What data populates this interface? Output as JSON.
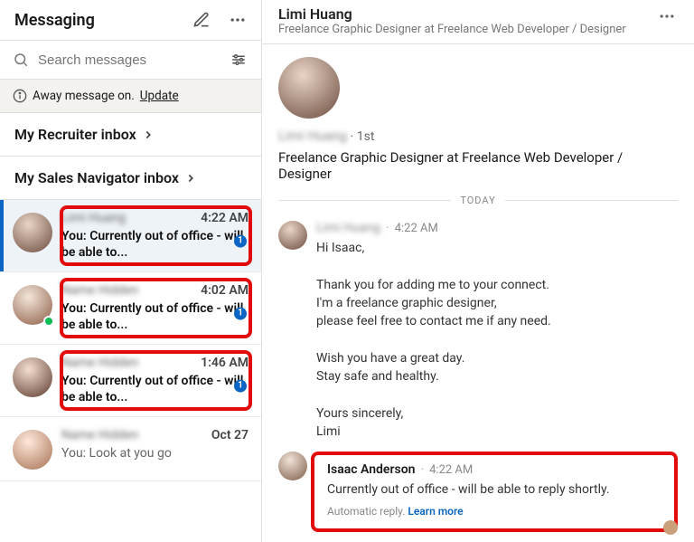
{
  "sidebar": {
    "title": "Messaging",
    "compose_label": "Compose",
    "more_label": "More",
    "search_placeholder": "Search messages",
    "filter_label": "Filter",
    "away_banner": {
      "text": "Away message on.",
      "update_label": "Update"
    },
    "sections": {
      "recruiter": "My Recruiter inbox",
      "sales": "My Sales Navigator inbox"
    },
    "threads": [
      {
        "name": "Limi Huang",
        "time": "4:22 AM",
        "snippet": "You: Currently out of office - will be able to...",
        "unread": "1",
        "presence": false,
        "active": true,
        "highlighted": true
      },
      {
        "name": "Name Hidden",
        "time": "4:02 AM",
        "snippet": "You: Currently out of office - will be able to...",
        "unread": "1",
        "presence": true,
        "active": false,
        "highlighted": true
      },
      {
        "name": "Name Hidden",
        "time": "1:46 AM",
        "snippet": "You: Currently out of office - will be able to...",
        "unread": "1",
        "presence": false,
        "active": false,
        "highlighted": true
      },
      {
        "name": "Name Hidden",
        "time": "Oct 27",
        "snippet": "You: Look at you go",
        "unread": "",
        "presence": false,
        "active": false,
        "highlighted": false
      }
    ]
  },
  "conversation": {
    "header": {
      "name": "Limi Huang",
      "subtitle": "Freelance Graphic Designer at Freelance Web Developer / Designer"
    },
    "profile": {
      "name": "Limi Huang",
      "degree": "1st",
      "headline": "Freelance Graphic Designer at Freelance Web Developer / Designer"
    },
    "divider": "TODAY",
    "messages": [
      {
        "sender": "Limi Huang",
        "time": "4:22 AM",
        "sender_blur": true,
        "text": "Hi Isaac,\n\nThank you for adding me to your connect.\nI'm a freelance graphic designer,\nplease feel free to contact me if any need.\n\nWish you have a great day.\nStay safe and healthy.\n\nYours sincerely,\nLimi",
        "auto_reply": false
      },
      {
        "sender": "Isaac Anderson",
        "time": "4:22 AM",
        "sender_blur": false,
        "text": "Currently out of office - will be able to reply shortly.",
        "auto_reply": true,
        "auto_reply_tag": "Automatic reply.",
        "learn_more": "Learn more"
      }
    ]
  }
}
